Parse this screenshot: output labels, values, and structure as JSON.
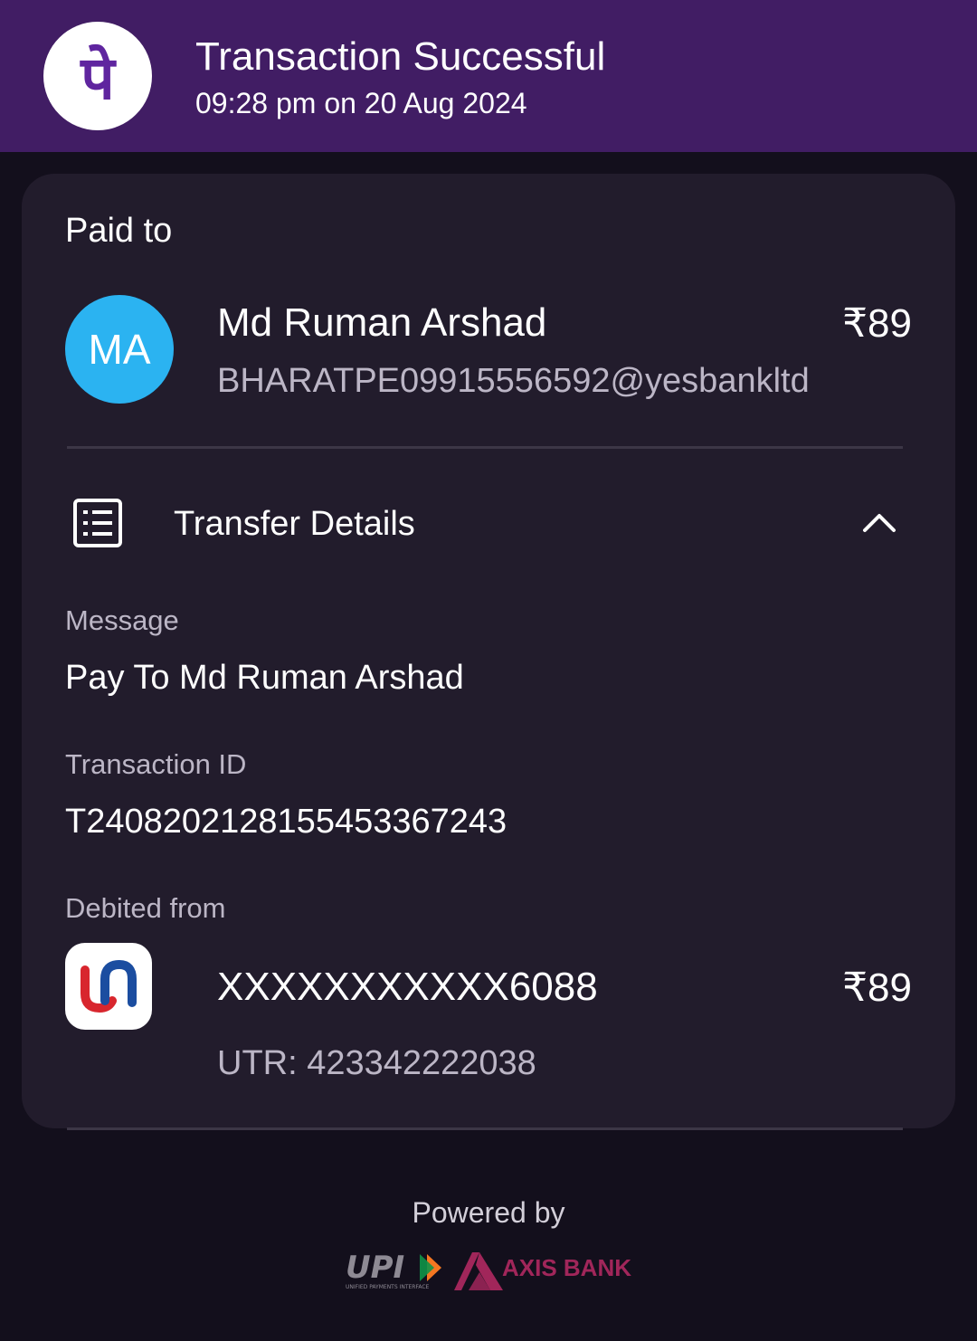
{
  "header": {
    "logo_glyph": "पे",
    "title": "Transaction Successful",
    "subtitle": "09:28 pm on 20 Aug 2024",
    "background_color": "#411d64"
  },
  "paid_to": {
    "label": "Paid to",
    "avatar_initials": "MA",
    "avatar_color": "#2bb3f1",
    "name": "Md Ruman Arshad",
    "vpa": "BHARATPE09915556592@yesbankltd",
    "amount": "₹89"
  },
  "transfer_details": {
    "label": "Transfer Details",
    "icon": "receipt-list-icon",
    "toggle_icon": "chevron-up-icon",
    "message_label": "Message",
    "message_value": "Pay To Md Ruman Arshad",
    "transaction_id_label": "Transaction ID",
    "transaction_id_value": "T2408202128155453367243",
    "debited_from_label": "Debited from",
    "bank_icon": "union-bank-logo-icon",
    "account_number": "XXXXXXXXXXX6088",
    "debit_amount": "₹89",
    "utr": "UTR: 423342222038"
  },
  "footer": {
    "powered_by": "Powered by",
    "upi_text": "UPI",
    "upi_tagline": "UNIFIED PAYMENTS INTERFACE",
    "bank_name": "AXIS BANK",
    "bank_color": "#a1265a"
  }
}
